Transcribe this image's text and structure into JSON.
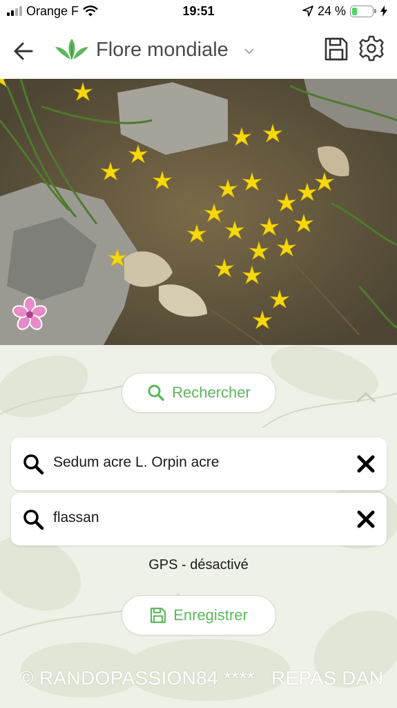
{
  "status_bar": {
    "carrier": "Orange F",
    "time": "19:51",
    "battery": "24 %",
    "battery_level": 0.24,
    "battery_color": "#4cd964"
  },
  "header": {
    "title": "Flore mondiale",
    "icons": [
      "back-arrow-icon",
      "leaf-logo-icon",
      "chevron-down-icon",
      "floppy-disk-icon",
      "gear-icon"
    ]
  },
  "search_button": {
    "label": "Rechercher",
    "icon": "search-icon"
  },
  "fields": [
    {
      "value": "Sedum acre L. Orpin acre",
      "icon": "search-icon",
      "clear_icon": "close-icon"
    },
    {
      "value": "flassan",
      "icon": "search-icon",
      "clear_icon": "close-icon"
    }
  ],
  "gps_status": "GPS - désactivé",
  "save_button": {
    "label": "Enregistrer",
    "icon": "floppy-disk-icon"
  },
  "marquee_text": "© RANDOPASSION84 ****   REPAS DAN",
  "colors": {
    "accent_green": "#5cb85c",
    "title_gray": "#4a4a4a",
    "flower_yellow": "#f5d90a"
  }
}
